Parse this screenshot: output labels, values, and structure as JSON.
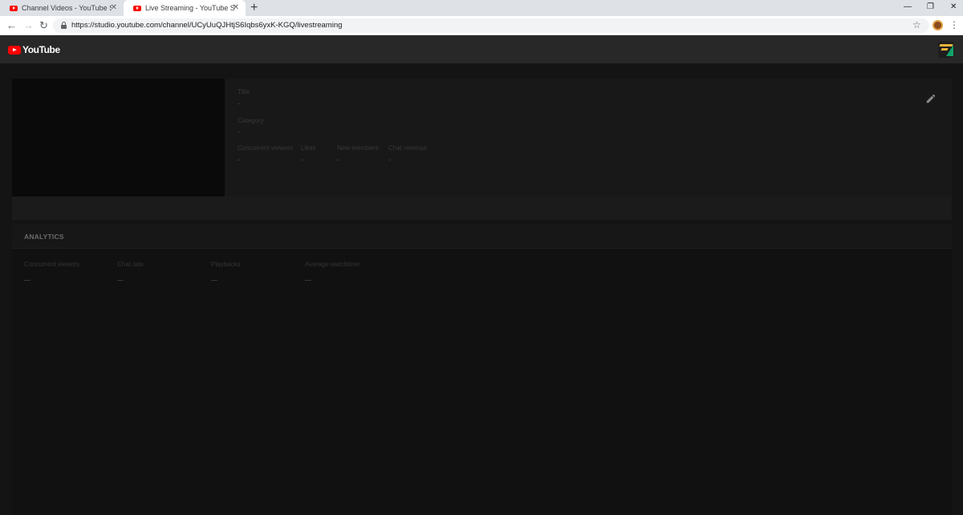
{
  "browser": {
    "tabs": [
      {
        "title": "Channel Videos - YouTube Studio",
        "active": false
      },
      {
        "title": "Live Streaming - YouTube Studio",
        "active": true
      }
    ],
    "new_tab_glyph": "+",
    "url": "https://studio.youtube.com/channel/UCyUuQJHtjS6Iqbs6yxK-KGQ/livestreaming",
    "window_controls": {
      "minimize": "—",
      "restore": "❐",
      "close": "✕"
    }
  },
  "header": {
    "logo_text": "YouTube",
    "logo_color": "#ff0000"
  },
  "stream_info": {
    "title_label": "Title",
    "title_value": "-",
    "category_label": "Category",
    "category_value": "-",
    "stats": [
      {
        "label": "Concurrent viewers",
        "value": "-"
      },
      {
        "label": "Likes",
        "value": "-"
      },
      {
        "label": "New members",
        "value": "-"
      },
      {
        "label": "Chat revenue",
        "value": "-"
      }
    ],
    "edit_icon": "pencil-icon"
  },
  "analytics": {
    "heading": "ANALYTICS",
    "metrics": [
      {
        "label": "Concurrent viewers",
        "value": "–"
      },
      {
        "label": "Chat rate",
        "value": "–"
      },
      {
        "label": "Playbacks",
        "value": "–"
      },
      {
        "label": "Average watchtime",
        "value": "–"
      }
    ]
  }
}
